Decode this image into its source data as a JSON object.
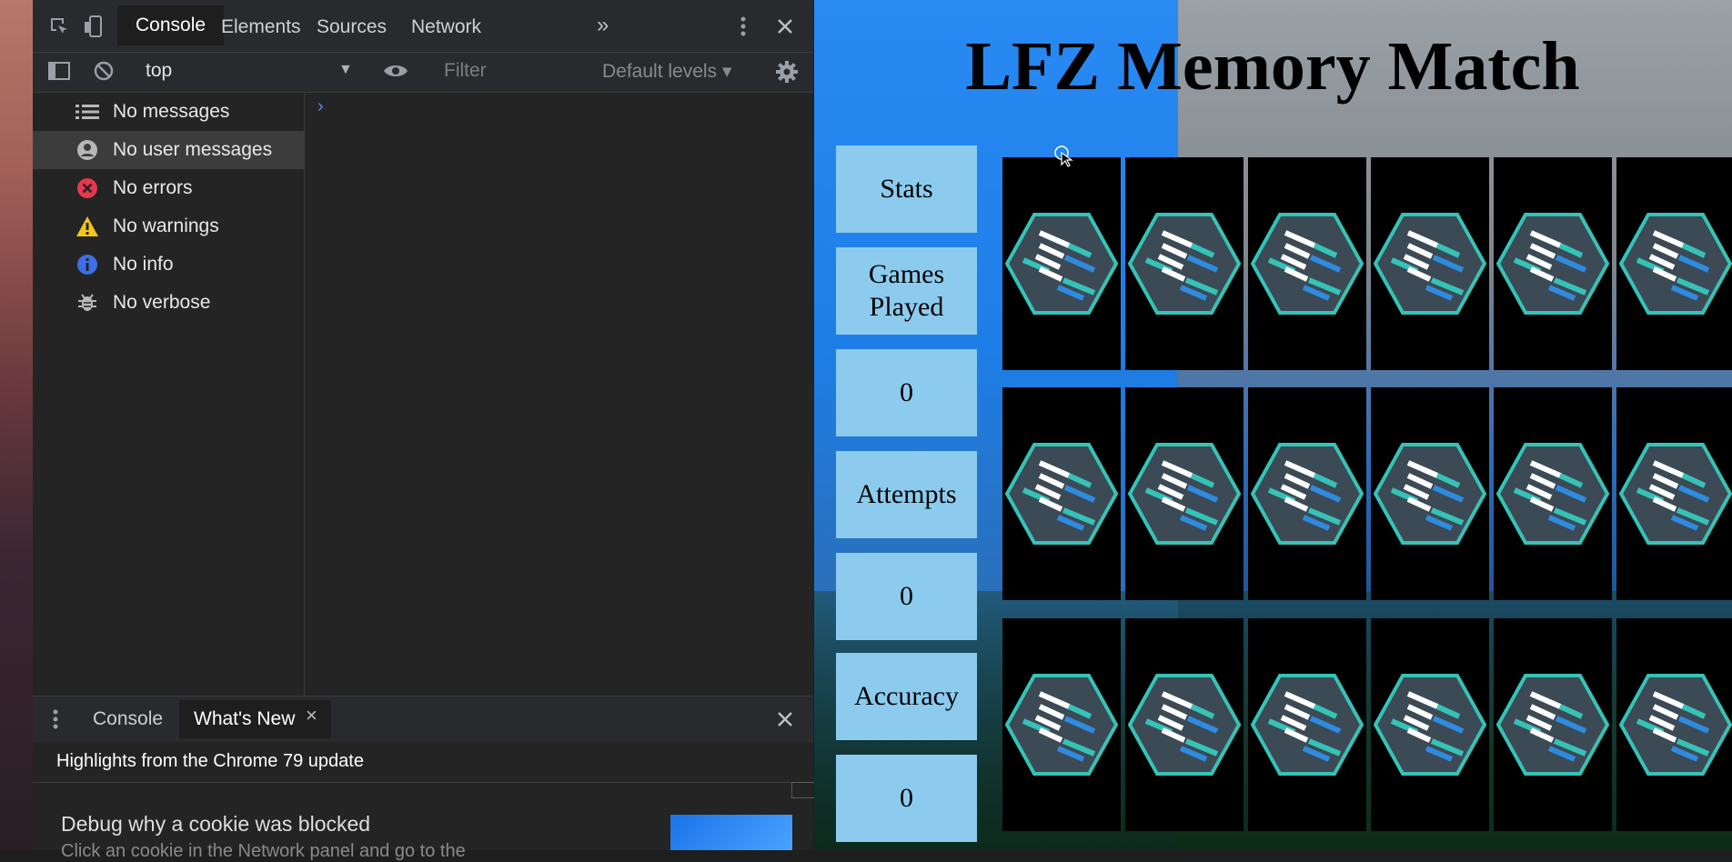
{
  "devtools": {
    "tabs": [
      "Console",
      "Elements",
      "Sources",
      "Network"
    ],
    "more_tabs": "»",
    "context": "top",
    "filter_placeholder": "Filter",
    "levels": "Default levels ▾",
    "sidebar": [
      {
        "label": "No messages",
        "icon": "list-icon"
      },
      {
        "label": "No user messages",
        "icon": "user-icon"
      },
      {
        "label": "No errors",
        "icon": "error-icon"
      },
      {
        "label": "No warnings",
        "icon": "warning-icon"
      },
      {
        "label": "No info",
        "icon": "info-icon"
      },
      {
        "label": "No verbose",
        "icon": "bug-icon"
      }
    ],
    "prompt": "›",
    "drawer": {
      "tabs": [
        "Console",
        "What's New"
      ],
      "close_tab": "×",
      "highlights": "Highlights from the Chrome 79 update",
      "debug_title": "Debug why a cookie was blocked",
      "debug_sub": "Click an cookie in the Network panel and go to the"
    },
    "colors": {
      "accent": "#4d90fe",
      "error": "#e8374e",
      "warning": "#f5c518",
      "info": "#3d6fe6"
    }
  },
  "game": {
    "title": "LFZ Memory Match",
    "stats_header": "Stats",
    "games_played_label": "Games Played",
    "games_played_value": "0",
    "attempts_label": "Attempts",
    "attempts_value": "0",
    "accuracy_label": "Accuracy",
    "accuracy_value": "0",
    "card_rows": 3,
    "card_cols": 6
  }
}
